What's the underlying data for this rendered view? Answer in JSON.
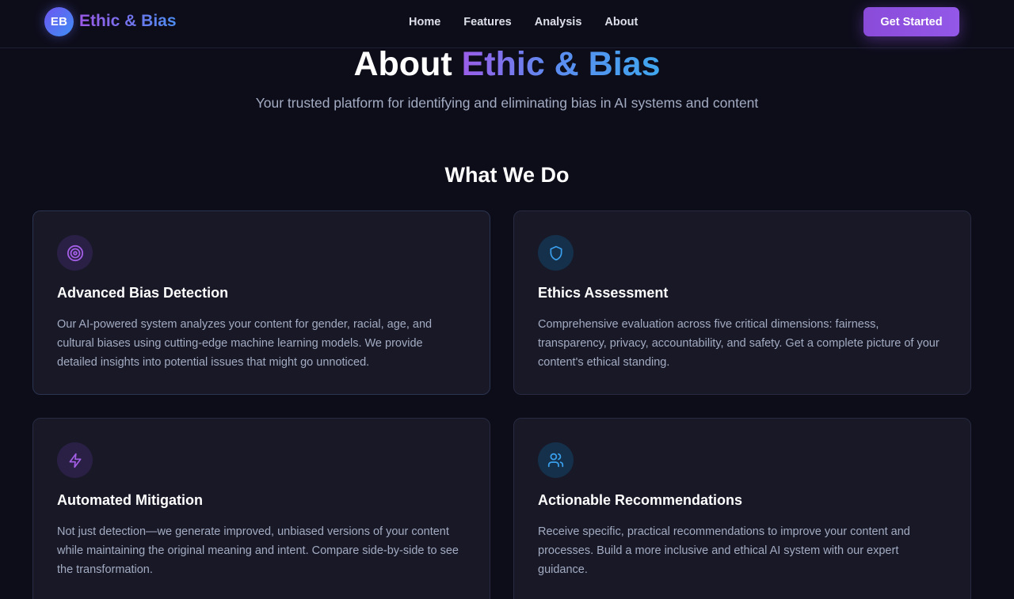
{
  "brand": {
    "badge": "EB",
    "name": "Ethic & Bias"
  },
  "nav": {
    "items": [
      "Home",
      "Features",
      "Analysis",
      "About"
    ],
    "cta_label": "Get Started"
  },
  "hero": {
    "title_plain": "About ",
    "title_accent": "Ethic & Bias",
    "subtitle": "Your trusted platform for identifying and eliminating bias in AI systems and content"
  },
  "section": {
    "title": "What We Do"
  },
  "cards": [
    {
      "icon": "target-icon",
      "title": "Advanced Bias Detection",
      "text": "Our AI-powered system analyzes your content for gender, racial, age, and cultural biases using cutting-edge machine learning models. We provide detailed insights into potential issues that might go unnoticed."
    },
    {
      "icon": "shield-icon",
      "title": "Ethics Assessment",
      "text": "Comprehensive evaluation across five critical dimensions: fairness, transparency, privacy, accountability, and safety. Get a complete picture of your content's ethical standing."
    },
    {
      "icon": "lightning-icon",
      "title": "Automated Mitigation",
      "text": "Not just detection—we generate improved, unbiased versions of your content while maintaining the original meaning and intent. Compare side-by-side to see the transformation."
    },
    {
      "icon": "users-icon",
      "title": "Actionable Recommendations",
      "text": "Receive specific, practical recommendations to improve your content and processes. Build a more inclusive and ethical AI system with our expert guidance."
    }
  ],
  "colors": {
    "background": "#0d0d1a",
    "card_background": "#181827",
    "accent_purple": "#8a4bd9",
    "accent_blue": "#3aa0ee",
    "muted_text": "#a3acc2"
  }
}
